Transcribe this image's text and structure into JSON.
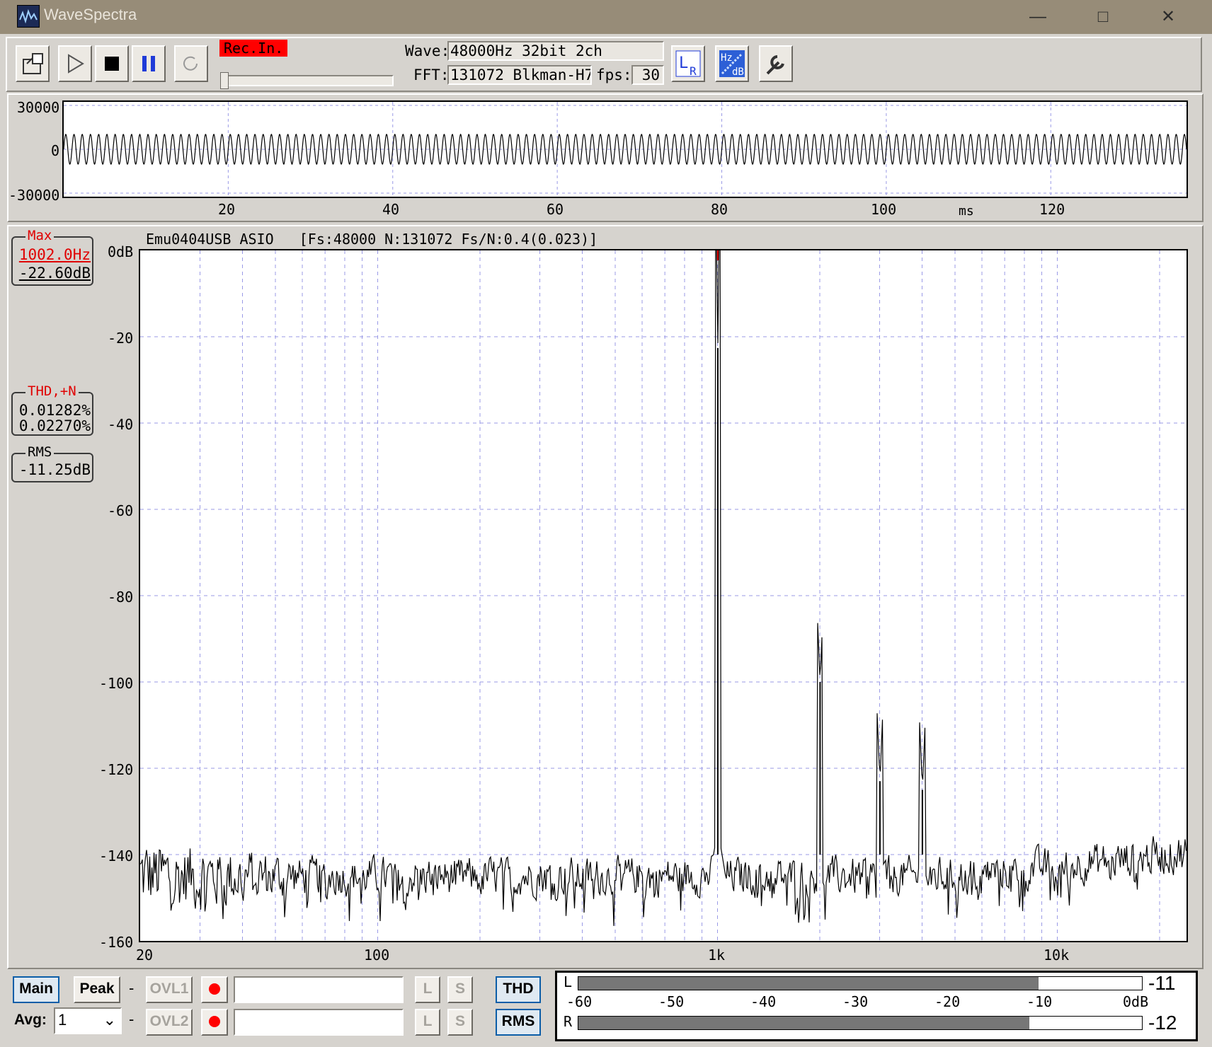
{
  "window": {
    "title": "WaveSpectra",
    "minimize": "—",
    "maximize": "□",
    "close": "✕"
  },
  "toolbar": {
    "rec_in_label": "Rec.In.",
    "wave_label": "Wave:",
    "wave_value": "48000Hz 32bit 2ch",
    "fft_label": "FFT:",
    "fft_value": "131072 Blkman-H7",
    "fps_label": "fps:",
    "fps_value": "30",
    "lr_button": "L R",
    "hzdb_button": "Hz dB"
  },
  "waveform": {
    "y_ticks": [
      "30000",
      "0",
      "-30000"
    ],
    "x_ticks": [
      "20",
      "40",
      "60",
      "80",
      "100",
      "120"
    ],
    "x_unit": "ms",
    "x_max_ms": 136.5,
    "y_range": [
      -30000,
      30000
    ],
    "frequency_hz": 1000,
    "amplitude": 10200
  },
  "spectrum": {
    "header": "Emu0404USB ASIO   [Fs:48000 N:131072 Fs/N:0.4(0.023)]",
    "y_unit_label": "0dB",
    "y_ticks": [
      "-20",
      "-40",
      "-60",
      "-80",
      "-100",
      "-120",
      "-140",
      "-160"
    ],
    "x_ticks": [
      "20",
      "100",
      "1k",
      "10k"
    ],
    "max_box": {
      "title": "Max",
      "freq": "1002.0Hz",
      "level": "-22.60dB"
    },
    "thd_box": {
      "title": "THD,+N",
      "thd": "0.01282%",
      "thdn": "0.02270%"
    },
    "rms_box": {
      "title": "RMS",
      "level": "-11.25dB"
    }
  },
  "chart_data": {
    "type": "line",
    "x_scale": "log",
    "x_range_hz": [
      20,
      24000
    ],
    "y_range_db": [
      -160,
      0
    ],
    "x_tick_labels": [
      "20",
      "100",
      "1k",
      "10k"
    ],
    "y_tick_labels": [
      "0dB",
      "-20",
      "-40",
      "-60",
      "-80",
      "-100",
      "-120",
      "-140",
      "-160"
    ],
    "noise_floor_db": -144,
    "peaks": [
      {
        "freq_hz": 1002,
        "level_db": -22.6
      },
      {
        "freq_hz": 2004,
        "level_db": -100
      },
      {
        "freq_hz": 3006,
        "level_db": -123
      },
      {
        "freq_hz": 4008,
        "level_db": -125
      }
    ]
  },
  "bottom": {
    "main": "Main",
    "peak": "Peak",
    "dash1": "-",
    "ovl1": "OVL1",
    "ovl2": "OVL2",
    "avg_label": "Avg:",
    "avg_value": "1",
    "dash2": "-",
    "l1": "L",
    "s1": "S",
    "l2": "L",
    "s2": "S",
    "thd": "THD",
    "rms": "RMS"
  },
  "meter": {
    "left_label": "L",
    "right_label": "R",
    "ticks": [
      "-60",
      "-50",
      "-40",
      "-30",
      "-20",
      "-10",
      "0dB"
    ],
    "left_value": "-11",
    "right_value": "-12",
    "left_level_db": -11,
    "right_level_db": -12,
    "range_db": [
      -60,
      0
    ]
  }
}
